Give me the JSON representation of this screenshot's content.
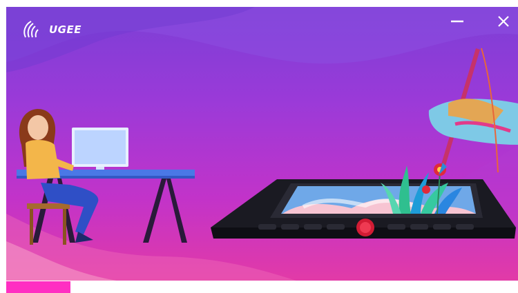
{
  "app": {
    "brand": "UGEE"
  },
  "window_controls": {
    "minimize_icon": "minimize-icon",
    "close_icon": "close-icon"
  },
  "progress": {
    "fraction": 0.126
  },
  "colors": {
    "progress_fill": "#ff2fc2",
    "background_top": "#7b3fd6",
    "background_bottom": "#e23aa7"
  }
}
